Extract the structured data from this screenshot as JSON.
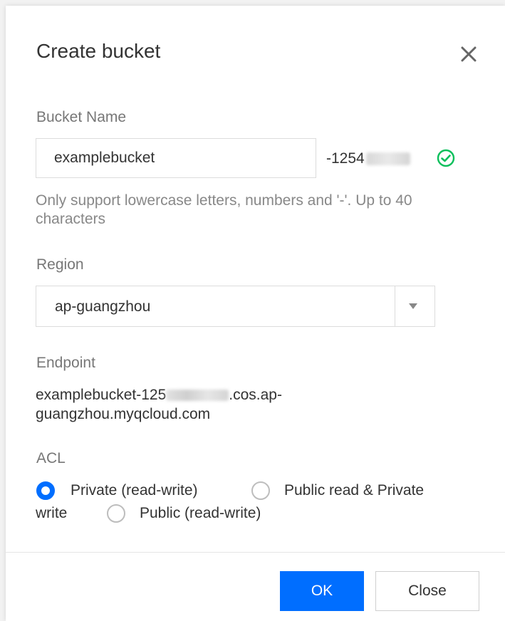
{
  "dialog": {
    "title": "Create bucket"
  },
  "bucket_name": {
    "label": "Bucket Name",
    "value": "examplebucket",
    "suffix_prefix": "-1254",
    "hint": "Only support lowercase letters, numbers and '-'. Up to 40 characters"
  },
  "region": {
    "label": "Region",
    "selected": "ap-guangzhou"
  },
  "endpoint": {
    "label": "Endpoint",
    "text_start": "examplebucket-125",
    "text_end": ".cos.ap-guangzhou.myqcloud.com"
  },
  "acl": {
    "label": "ACL",
    "options": [
      {
        "label": "Private (read-write)",
        "checked": true
      },
      {
        "label": "Public read & Private",
        "continuation": "write",
        "checked": false
      },
      {
        "label": "Public (read-write)",
        "checked": false
      }
    ]
  },
  "footer": {
    "ok_label": "OK",
    "close_label": "Close"
  },
  "colors": {
    "primary": "#006eff",
    "success": "#0abf5b"
  },
  "icons": {
    "close": "close-icon",
    "valid": "check-circle-icon",
    "dropdown": "caret-down-icon"
  }
}
